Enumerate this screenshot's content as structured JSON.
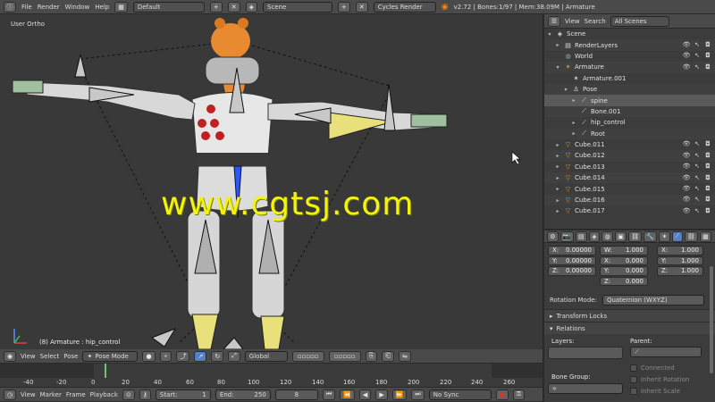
{
  "topbar": {
    "menus": [
      "File",
      "Render",
      "Window",
      "Help"
    ],
    "layout": "Default",
    "scene": "Scene",
    "engine": "Cycles Render",
    "stats": "v2.72 | Bones:1/97  | Mem:38.09M | Armature"
  },
  "viewport": {
    "label": "User Ortho",
    "status": "(8) Armature : hip_control",
    "watermark": "www.cgtsj.com"
  },
  "viewport_header": {
    "menus": [
      "View",
      "Select",
      "Pose"
    ],
    "mode": "Pose Mode",
    "orientation": "Global"
  },
  "timeline": {
    "ticks": [
      "-40",
      "-20",
      "0",
      "20",
      "40",
      "60",
      "80",
      "100",
      "120",
      "140",
      "160",
      "180",
      "200",
      "220",
      "240",
      "260"
    ],
    "current_frame": 8
  },
  "timeline_header": {
    "menus": [
      "View",
      "Marker",
      "Frame",
      "Playback"
    ],
    "start_label": "Start:",
    "start": "1",
    "end_label": "End:",
    "end": "250",
    "frame": "8",
    "sync": "No Sync"
  },
  "outliner": {
    "menus": [
      "View",
      "Search"
    ],
    "filter": "All Scenes",
    "rows": [
      {
        "label": "Scene",
        "indent": 0,
        "icon": "scene-icon",
        "twisty": "▾"
      },
      {
        "label": "RenderLayers",
        "indent": 1,
        "icon": "renderlayers-icon",
        "twisty": "▸"
      },
      {
        "label": "World",
        "indent": 1,
        "icon": "world-icon",
        "twisty": ""
      },
      {
        "label": "Armature",
        "indent": 1,
        "icon": "armature-icon",
        "twisty": "▾"
      },
      {
        "label": "Armature.001",
        "indent": 2,
        "icon": "armature-data-icon",
        "twisty": ""
      },
      {
        "label": "Pose",
        "indent": 2,
        "icon": "pose-icon",
        "twisty": "▾"
      },
      {
        "label": "spine",
        "indent": 3,
        "icon": "bone-icon",
        "twisty": "▸",
        "selected": true
      },
      {
        "label": "Bone.001",
        "indent": 3,
        "icon": "bone-icon",
        "twisty": ""
      },
      {
        "label": "hip_control",
        "indent": 3,
        "icon": "bone-icon",
        "twisty": "▸"
      },
      {
        "label": "Root",
        "indent": 3,
        "icon": "bone-icon",
        "twisty": "▸"
      },
      {
        "label": "Cube.011",
        "indent": 1,
        "icon": "mesh-icon",
        "twisty": "▸"
      },
      {
        "label": "Cube.012",
        "indent": 1,
        "icon": "mesh-icon",
        "twisty": "▸"
      },
      {
        "label": "Cube.013",
        "indent": 1,
        "icon": "mesh-icon",
        "twisty": "▸"
      },
      {
        "label": "Cube.014",
        "indent": 1,
        "icon": "mesh-icon",
        "twisty": "▸"
      },
      {
        "label": "Cube.015",
        "indent": 1,
        "icon": "mesh-icon",
        "twisty": "▸"
      },
      {
        "label": "Cube.016",
        "indent": 1,
        "icon": "mesh-icon",
        "twisty": "▸"
      },
      {
        "label": "Cube.017",
        "indent": 1,
        "icon": "mesh-icon",
        "twisty": "▸"
      }
    ]
  },
  "properties": {
    "location": [
      {
        "label": "X:",
        "value": "0.00000"
      },
      {
        "label": "Y:",
        "value": "0.00000"
      },
      {
        "label": "Z:",
        "value": "0.00000"
      }
    ],
    "rotation": [
      {
        "label": "W:",
        "value": "1.000"
      },
      {
        "label": "X:",
        "value": "0.000"
      },
      {
        "label": "Y:",
        "value": "0.000"
      },
      {
        "label": "Z:",
        "value": "0.000"
      }
    ],
    "scale": [
      {
        "label": "X:",
        "value": "1.000"
      },
      {
        "label": "Y:",
        "value": "1.000"
      },
      {
        "label": "Z:",
        "value": "1.000"
      }
    ],
    "rotation_mode_label": "Rotation Mode:",
    "rotation_mode": "Quaternion (WXYZ)",
    "transform_locks": "Transform Locks",
    "relations": "Relations",
    "layers_label": "Layers:",
    "parent_label": "Parent:",
    "connected": "Connected",
    "inherit_rotation": "Inherit Rotation",
    "inherit_scale": "Inherit Scale",
    "bone_group_label": "Bone Group:"
  }
}
